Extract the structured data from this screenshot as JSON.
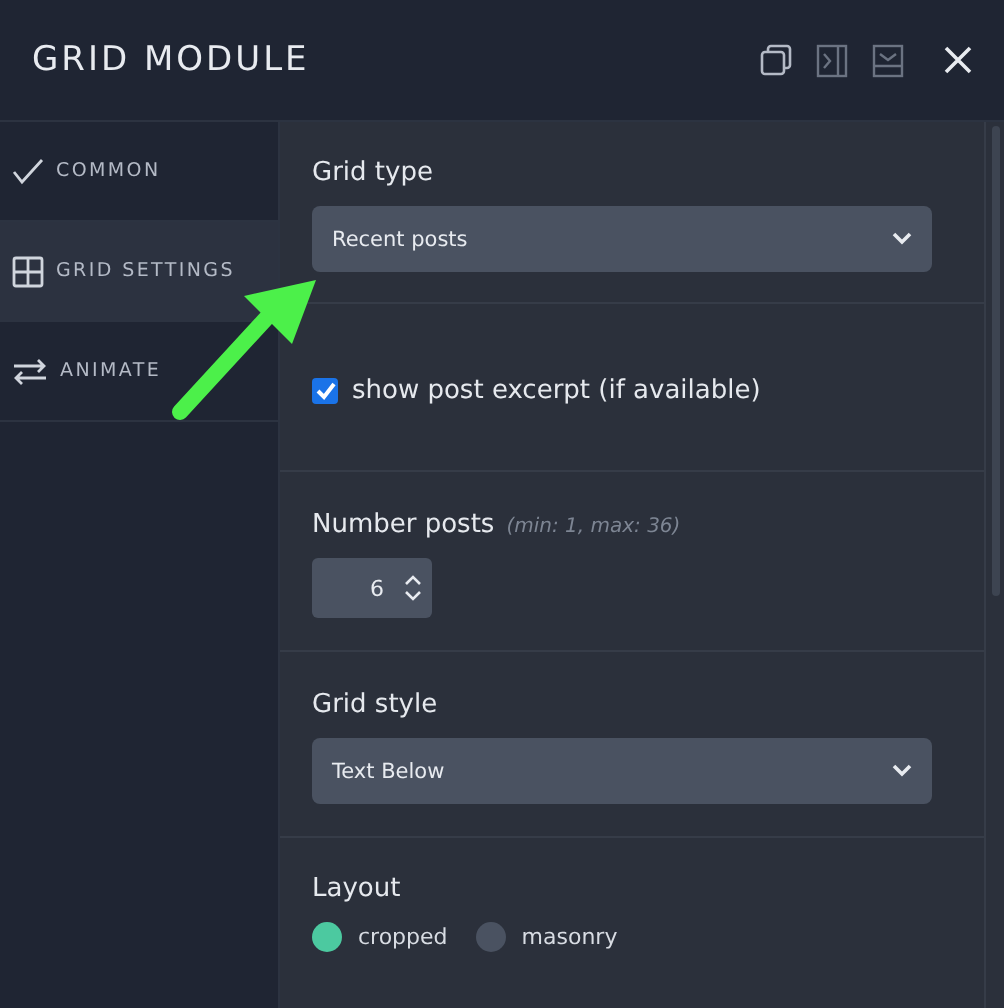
{
  "window": {
    "title": "GRID MODULE"
  },
  "tabs": [
    {
      "label": "COMMON",
      "selected": false
    },
    {
      "label": "GRID SETTINGS",
      "selected": true
    },
    {
      "label": "ANIMATE",
      "selected": false
    }
  ],
  "grid_type": {
    "label": "Grid type",
    "value": "Recent posts"
  },
  "show_excerpt": {
    "label": "show post excerpt (if available)",
    "checked": true
  },
  "number_posts": {
    "label": "Number posts",
    "hint": "(min: 1, max: 36)",
    "value": "6"
  },
  "grid_style": {
    "label": "Grid style",
    "value": "Text Below"
  },
  "layout": {
    "label": "Layout",
    "options": [
      {
        "label": "cropped",
        "selected": true
      },
      {
        "label": "masonry",
        "selected": false
      }
    ]
  }
}
